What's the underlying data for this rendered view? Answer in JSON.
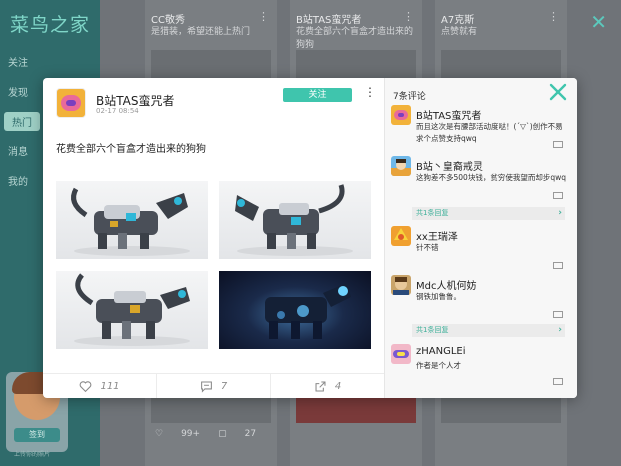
{
  "background": {
    "app_title": "菜鸟之家",
    "nav_items": [
      "关注",
      "发现",
      "热门",
      "消息",
      "我的"
    ],
    "active_nav": "热门",
    "avatar_button": "签到",
    "avatar_caption": "上传你的照片",
    "cards": [
      {
        "title": "CC敬秀",
        "subtitle": "是猎装，希望还能上热门",
        "likes": "",
        "comments": "",
        "footer": ""
      },
      {
        "title": "B站TAS蛮咒者",
        "subtitle": "花费全部六个盲盒才造出来的狗狗",
        "likes": "99+",
        "comments": "27",
        "footer": ""
      },
      {
        "title": "A7克斯",
        "subtitle": "点赞就有",
        "likes": "",
        "comments": "",
        "footer": ""
      }
    ],
    "close_icon": "close-icon"
  },
  "post": {
    "author": "B站TAS蛮咒者",
    "time": "02-17 08:54",
    "follow_label": "关注",
    "text": "花费全部六个盲盒才造出来的狗狗",
    "likes": "111",
    "comments": "7",
    "shares": "4",
    "photos": [
      "lego-dog-photo-1",
      "lego-dog-photo-2",
      "lego-dog-photo-3",
      "lego-dog-photo-dark"
    ]
  },
  "comments": {
    "count_label": "7条评论",
    "items": [
      {
        "user": "B站TAS蛮咒者",
        "text": "而且这次是有腰部活动度哒！(ˊ▽ˋ)创作不易求个点赞支持qwq",
        "replies": ""
      },
      {
        "user": "B站丶皇裔戒灵",
        "text": "这狗差不多500块钱，贫穷使我望而却步qwq",
        "replies": "共1条回复"
      },
      {
        "user": "xx王瑞泽",
        "text": "针不错",
        "replies": ""
      },
      {
        "user": "Mdc人机何妨",
        "text": "钢铁加鲁鲁。",
        "replies": "共1条回复"
      },
      {
        "user": "zHANGLEi",
        "text": "作者是个人才",
        "replies": ""
      }
    ]
  },
  "colors": {
    "accent": "#3fc5ad",
    "sidebar": "#2f6b6b"
  }
}
